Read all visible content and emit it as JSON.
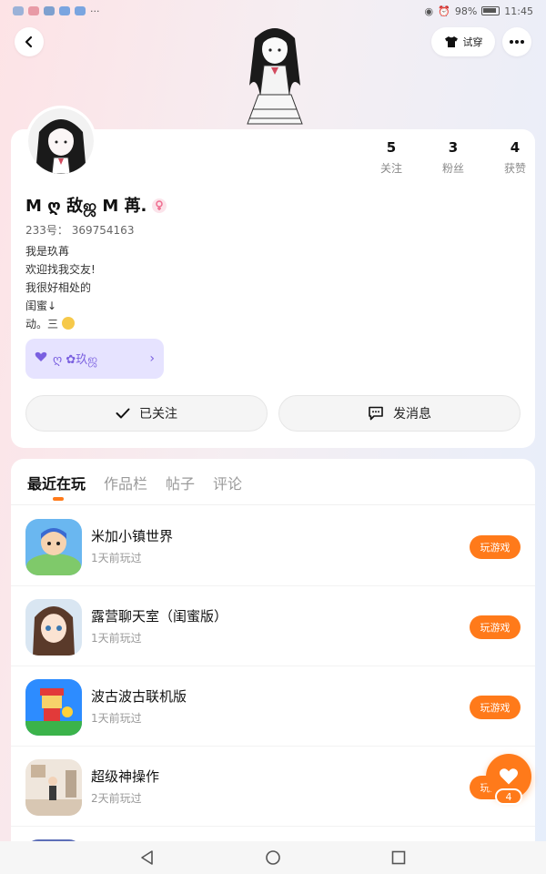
{
  "status_bar": {
    "battery": "98%",
    "time": "11:45",
    "left_extra": "···"
  },
  "header": {
    "tryon_label": "试穿"
  },
  "profile": {
    "nickname": "M ღ 敌ஜ M 苒.",
    "uid_label": "233号：",
    "uid": "369754163",
    "bio_lines": [
      "我是玖苒",
      "欢迎找我交友!",
      "我很好相处的",
      "闺蜜↓",
      "动。三"
    ],
    "club_text": "ღ ✿玖ஜ"
  },
  "stats": [
    {
      "value": "5",
      "label": "关注"
    },
    {
      "value": "3",
      "label": "粉丝"
    },
    {
      "value": "4",
      "label": "获赞"
    }
  ],
  "actions": {
    "follow_label": "已关注",
    "message_label": "发消息"
  },
  "tabs": [
    {
      "label": "最近在玩",
      "active": true
    },
    {
      "label": "作品栏",
      "active": false
    },
    {
      "label": "帖子",
      "active": false
    },
    {
      "label": "评论",
      "active": false
    }
  ],
  "games": [
    {
      "name": "米加小镇世界",
      "time": "1天前玩过",
      "button": "玩游戏"
    },
    {
      "name": "露营聊天室（闺蜜版）",
      "time": "1天前玩过",
      "button": "玩游戏"
    },
    {
      "name": "波古波古联机版",
      "time": "1天前玩过",
      "button": "玩游戏"
    },
    {
      "name": "超级神操作",
      "time": "2天前玩过",
      "button": "玩游戏"
    }
  ],
  "fab": {
    "count": "4"
  },
  "colors": {
    "accent": "#ff7a1a",
    "club_bg": "#e6e3ff",
    "club_text": "#7a60e0"
  }
}
